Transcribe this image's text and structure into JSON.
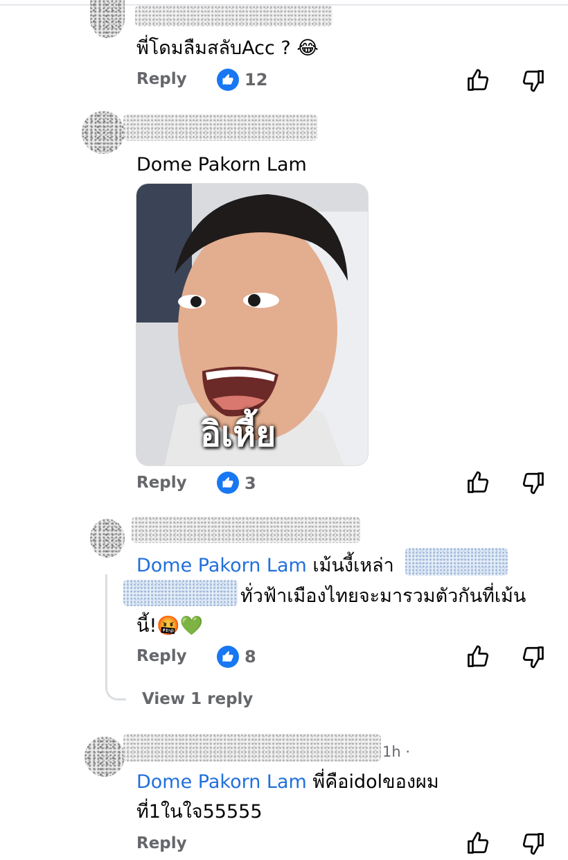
{
  "colors": {
    "mention": "#216fdb",
    "action_gray": "#65676b",
    "like_blue": "#1877f2",
    "text": "#050505"
  },
  "comments": [
    {
      "text": "พี่โดมลืมสลับAcc ? 😂",
      "reply_label": "Reply",
      "likes": "12",
      "like_icon": "thumbs-up-icon",
      "upvote_icon": "thumbs-up-outline-icon",
      "downvote_icon": "thumbs-down-outline-icon"
    },
    {
      "text": "Dome Pakorn Lam",
      "gif_caption": "อิเหี้ย",
      "reply_label": "Reply",
      "likes": "3"
    },
    {
      "mention": "Dome Pakorn Lam",
      "text_line1": "เม้นงี้เหล่า",
      "text_line2": "ทั่วฟ้าเมืองไทยจะมารวมตัวกันที่เม้น",
      "text_line3": "นี้!🤬💚",
      "reply_label": "Reply",
      "likes": "8",
      "view_replies": "View 1 reply"
    },
    {
      "time": "1h ·",
      "mention": "Dome Pakorn Lam",
      "text_line1": "พี่คือidolของผม",
      "text_line2": "ที่1ในใจ55555",
      "reply_label": "Reply"
    }
  ]
}
